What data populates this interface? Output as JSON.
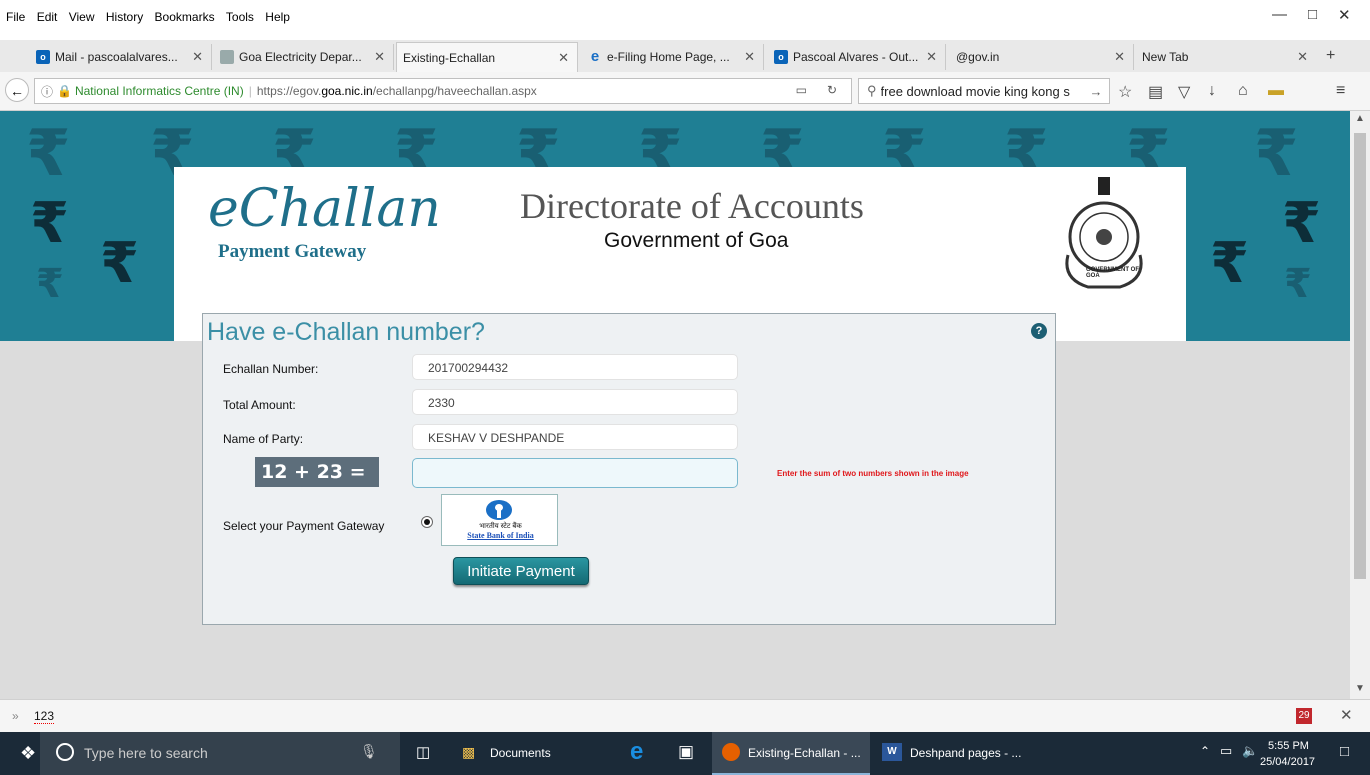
{
  "menubar": {
    "items": [
      "File",
      "Edit",
      "View",
      "History",
      "Bookmarks",
      "Tools",
      "Help"
    ]
  },
  "tabs": [
    {
      "label": "Mail - pascoalalvares...",
      "icon": "outlook-icon"
    },
    {
      "label": "Goa Electricity Depar...",
      "icon": "emblem-icon"
    },
    {
      "label": "Existing-Echallan",
      "icon": "none"
    },
    {
      "label": "e-Filing Home Page, ...",
      "icon": "ie-icon"
    },
    {
      "label": "Pascoal Alvares - Out...",
      "icon": "outlook-icon"
    },
    {
      "label": "@gov.in",
      "icon": "none"
    },
    {
      "label": "New Tab",
      "icon": "none"
    }
  ],
  "navbar": {
    "site_identity": "National Informatics Centre (IN)",
    "url_prefix": "https://egov.",
    "url_domain": "goa.nic.in",
    "url_path": "/echallanpg/haveechallan.aspx",
    "search_value": "free download movie king kong s"
  },
  "header": {
    "logo_main": "eChallan",
    "logo_sub": "Payment Gateway",
    "title": "Directorate of Accounts",
    "subtitle": "Government of Goa",
    "emblem_text": "GOVERNMENT OF GOA"
  },
  "form": {
    "heading": "Have e-Challan number?",
    "echallan_label": "Echallan Number:",
    "echallan_value": "201700294432",
    "amount_label": "Total Amount:",
    "amount_value": "2330",
    "party_label": "Name of Party:",
    "party_value": "KESHAV V DESHPANDE",
    "captcha_text": "12 + 23 =",
    "captcha_hint": "Enter the sum of two numbers shown in the image",
    "gateway_label": "Select your Payment Gateway",
    "sbi_hindi": "भारतीय स्टेट बैंक",
    "sbi_name": "State Bank of India",
    "submit_label": "Initiate Payment"
  },
  "findbar": {
    "value": "123",
    "badge": "29"
  },
  "taskbar": {
    "search_placeholder": "Type here to search",
    "apps": [
      "Documents",
      "Existing-Echallan - ...",
      "Deshpand pages - ..."
    ],
    "time": "5:55 PM",
    "date": "25/04/2017"
  },
  "colors": {
    "teal": "#1f7f94",
    "heading": "#3b8fa6",
    "hint_red": "#e0181b",
    "button": "#1d7c86"
  }
}
